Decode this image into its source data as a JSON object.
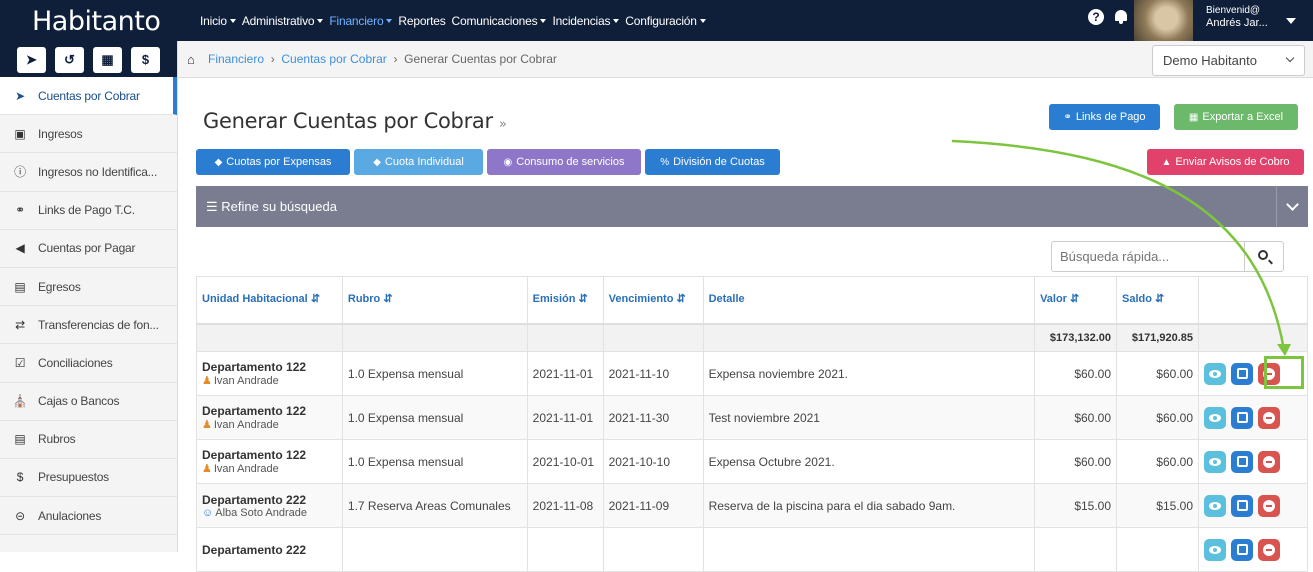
{
  "brand": "Habitanto",
  "menu": [
    {
      "label": "Inicio"
    },
    {
      "label": "Administrativo"
    },
    {
      "label": "Financiero"
    },
    {
      "label": "Reportes"
    },
    {
      "label": "Comunicaciones"
    },
    {
      "label": "Incidencias"
    },
    {
      "label": "Configuración"
    }
  ],
  "user": {
    "greeting": "Bienvenid@",
    "name": "Andrés Jar..."
  },
  "quick_icons": [
    "paper-plane-icon",
    "history-icon",
    "calculator-icon",
    "dollar-icon"
  ],
  "sidebar": [
    {
      "label": "Cuentas por Cobrar",
      "icon": "chevron-circle-right-icon",
      "active": true
    },
    {
      "label": "Ingresos",
      "icon": "money-icon"
    },
    {
      "label": "Ingresos no Identifica...",
      "icon": "question-circle-icon"
    },
    {
      "label": "Links de Pago T.C.",
      "icon": "link-icon"
    },
    {
      "label": "Cuentas por Pagar",
      "icon": "chevron-circle-left-icon"
    },
    {
      "label": "Egresos",
      "icon": "credit-card-icon"
    },
    {
      "label": "Transferencias de fon...",
      "icon": "exchange-icon"
    },
    {
      "label": "Conciliaciones",
      "icon": "check-square-icon"
    },
    {
      "label": "Cajas o Bancos",
      "icon": "bank-icon"
    },
    {
      "label": "Rubros",
      "icon": "list-alt-icon"
    },
    {
      "label": "Presupuestos",
      "icon": "dollar-icon"
    },
    {
      "label": "Anulaciones",
      "icon": "minus-circle-icon"
    }
  ],
  "breadcrumb": {
    "root": "Financiero",
    "mid": "Cuentas por Cobrar",
    "current": "Generar Cuentas por Cobrar"
  },
  "company_select": "Demo Habitanto",
  "page_title": "Generar Cuentas por Cobrar",
  "buttons": {
    "links_pago": "Links de Pago",
    "exportar": "Exportar a Excel",
    "cuotas_expensas": "Cuotas por Expensas",
    "cuota_individual": "Cuota Individual",
    "consumo": "Consumo de servicios",
    "division": "División de Cuotas",
    "avisos": "Enviar Avisos de Cobro"
  },
  "colors": {
    "primary": "#2a7dd1",
    "success": "#5cb85c",
    "purple": "#8e77c9",
    "danger": "#d9534f",
    "navbar": "#0f1f3a",
    "highlight": "#7dc43f"
  },
  "refine_label": "Refine su búsqueda",
  "search_placeholder": "Búsqueda rápida...",
  "table": {
    "headers": {
      "unidad": "Unidad Habitacional",
      "rubro": "Rubro",
      "emision": "Emisión",
      "vencimiento": "Vencimiento",
      "detalle": "Detalle",
      "valor": "Valor",
      "saldo": "Saldo"
    },
    "totals": {
      "valor": "$173,132.00",
      "saldo": "$171,920.85"
    },
    "rows": [
      {
        "unidad": "Departamento 122",
        "person": "Ivan Andrade",
        "rubro": "1.0 Expensa mensual",
        "emision": "2021-11-01",
        "vencimiento": "2021-11-10",
        "detalle": "Expensa noviembre 2021.",
        "valor": "$60.00",
        "saldo": "$60.00"
      },
      {
        "unidad": "Departamento 122",
        "person": "Ivan Andrade",
        "rubro": "1.0 Expensa mensual",
        "emision": "2021-11-01",
        "vencimiento": "2021-11-30",
        "detalle": "Test noviembre 2021",
        "valor": "$60.00",
        "saldo": "$60.00"
      },
      {
        "unidad": "Departamento 122",
        "person": "Ivan Andrade",
        "rubro": "1.0 Expensa mensual",
        "emision": "2021-10-01",
        "vencimiento": "2021-10-10",
        "detalle": "Expensa Octubre 2021.",
        "valor": "$60.00",
        "saldo": "$60.00"
      },
      {
        "unidad": "Departamento 222",
        "person": "Alba Soto Andrade",
        "rubro": "1.7 Reserva Areas Comunales",
        "emision": "2021-11-08",
        "vencimiento": "2021-11-09",
        "detalle": "Reserva de la piscina para el dia sabado 9am.",
        "valor": "$15.00",
        "saldo": "$15.00"
      },
      {
        "unidad": "Departamento 222",
        "person": "",
        "rubro": "",
        "emision": "",
        "vencimiento": "",
        "detalle": "",
        "valor": "",
        "saldo": ""
      }
    ]
  }
}
